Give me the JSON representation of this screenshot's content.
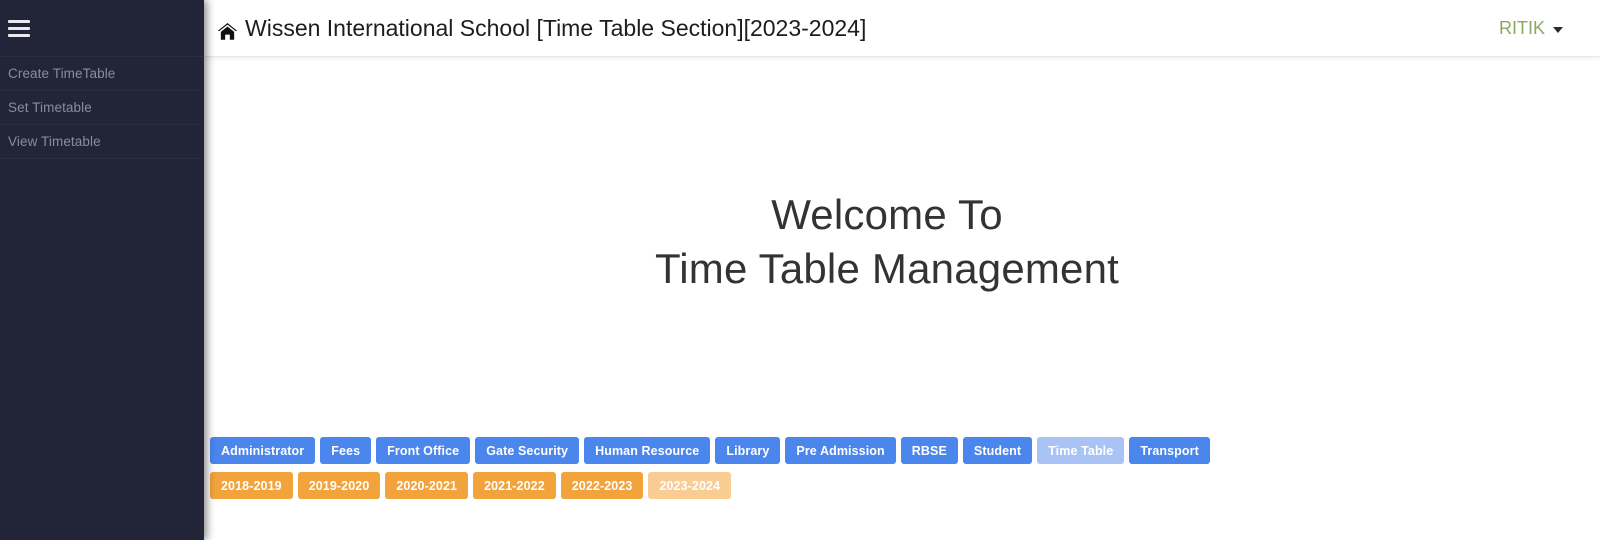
{
  "sidebar": {
    "menu_icon": "hamburger-icon",
    "items": [
      {
        "label": "Create TimeTable"
      },
      {
        "label": "Set Timetable"
      },
      {
        "label": "View Timetable"
      }
    ]
  },
  "header": {
    "home_icon": "home-icon",
    "title": "Wissen International School [Time Table Section][2023-2024]",
    "user": {
      "name": "RITIK",
      "caret_icon": "caret-down-icon"
    }
  },
  "main": {
    "welcome_line1": "Welcome To",
    "welcome_line2": "Time Table Management"
  },
  "modules": {
    "active": "Time Table",
    "items": [
      {
        "label": "Administrator",
        "active": false
      },
      {
        "label": "Fees",
        "active": false
      },
      {
        "label": "Front Office",
        "active": false
      },
      {
        "label": "Gate Security",
        "active": false
      },
      {
        "label": "Human Resource",
        "active": false
      },
      {
        "label": "Library",
        "active": false
      },
      {
        "label": "Pre Admission",
        "active": false
      },
      {
        "label": "RBSE",
        "active": false
      },
      {
        "label": "Student",
        "active": false
      },
      {
        "label": "Time Table",
        "active": true
      },
      {
        "label": "Transport",
        "active": false
      }
    ]
  },
  "sessions": {
    "active": "2023-2024",
    "items": [
      {
        "label": "2018-2019",
        "active": false
      },
      {
        "label": "2019-2020",
        "active": false
      },
      {
        "label": "2020-2021",
        "active": false
      },
      {
        "label": "2021-2022",
        "active": false
      },
      {
        "label": "2022-2023",
        "active": false
      },
      {
        "label": "2023-2024",
        "active": true
      }
    ]
  },
  "colors": {
    "sidebar_bg": "#222437",
    "module_blue": "#4a86ec",
    "module_blue_active": "#a9c4f4",
    "session_orange": "#f2a33c",
    "session_orange_active": "#f8cc92",
    "user_green": "#8aa95c"
  }
}
